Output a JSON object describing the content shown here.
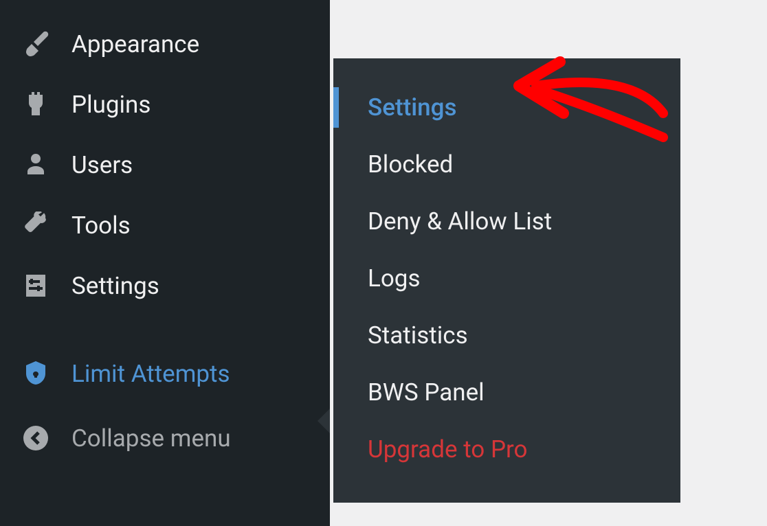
{
  "sidebar": {
    "items": [
      {
        "label": "Appearance",
        "icon": "brush"
      },
      {
        "label": "Plugins",
        "icon": "plug"
      },
      {
        "label": "Users",
        "icon": "user"
      },
      {
        "label": "Tools",
        "icon": "wrench"
      },
      {
        "label": "Settings",
        "icon": "sliders"
      },
      {
        "label": "Limit Attempts",
        "icon": "shield",
        "active": true
      }
    ],
    "collapse_label": "Collapse menu"
  },
  "flyout": {
    "items": [
      {
        "label": "Settings",
        "active": true
      },
      {
        "label": "Blocked"
      },
      {
        "label": "Deny & Allow List"
      },
      {
        "label": "Logs"
      },
      {
        "label": "Statistics"
      },
      {
        "label": "BWS Panel"
      },
      {
        "label": "Upgrade to Pro",
        "upgrade": true
      }
    ]
  }
}
